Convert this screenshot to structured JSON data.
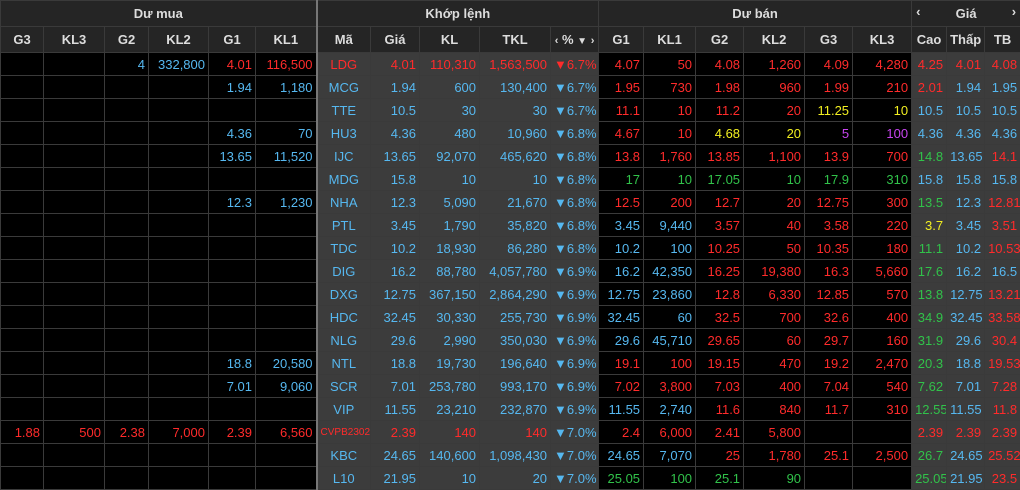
{
  "headers": {
    "buy": "Dư mua",
    "match": "Khớp lệnh",
    "sell": "Dư bán",
    "price": "Giá",
    "buy_cols": [
      "G3",
      "KL3",
      "G2",
      "KL2",
      "G1",
      "KL1"
    ],
    "match_cols": [
      "Mã",
      "Giá",
      "KL",
      "TKL",
      "%"
    ],
    "sell_cols": [
      "G1",
      "KL1",
      "G2",
      "KL2",
      "G3",
      "KL3"
    ],
    "price_cols": [
      "Cao",
      "Thấp",
      "TB"
    ],
    "pct_sort_icon": "triangle-down"
  },
  "colors": {
    "up": "#31c24a",
    "down": "#ff2b2b",
    "reference": "#e3d21d",
    "ceiling": "#c845f0",
    "floor": "#56b8f0",
    "highlight": "#f2ef21"
  },
  "rows": [
    {
      "c": [
        "",
        "",
        "4",
        "332,800",
        "4.01",
        "116,500",
        "LDG",
        "4.01",
        "110,310",
        "1,563,500",
        "▼6.7%",
        "4.07",
        "50",
        "4.08",
        "1,260",
        "4.09",
        "4,280",
        "4.25",
        "4.01",
        "4.08"
      ]
    },
    {
      "c": [
        "",
        "",
        "",
        "",
        "1.94",
        "1,180",
        "MCG",
        "1.94",
        "600",
        "130,400",
        "▼6.7%",
        "1.95",
        "730",
        "1.98",
        "960",
        "1.99",
        "210",
        "2.01",
        "1.94",
        "1.95"
      ]
    },
    {
      "c": [
        "",
        "",
        "",
        "",
        "",
        "",
        "TTE",
        "10.5",
        "30",
        "30",
        "▼6.7%",
        "11.1",
        "10",
        "11.2",
        "20",
        "11.25",
        "10",
        "10.5",
        "10.5",
        "10.5"
      ]
    },
    {
      "c": [
        "",
        "",
        "",
        "",
        "4.36",
        "70",
        "HU3",
        "4.36",
        "480",
        "10,960",
        "▼6.8%",
        "4.67",
        "10",
        "4.68",
        "20",
        "5",
        "100",
        "4.36",
        "4.36",
        "4.36"
      ]
    },
    {
      "c": [
        "",
        "",
        "",
        "",
        "13.65",
        "11,520",
        "IJC",
        "13.65",
        "92,070",
        "465,620",
        "▼6.8%",
        "13.8",
        "1,760",
        "13.85",
        "1,100",
        "13.9",
        "700",
        "14.8",
        "13.65",
        "14.1"
      ]
    },
    {
      "c": [
        "",
        "",
        "",
        "",
        "",
        "",
        "MDG",
        "15.8",
        "10",
        "10",
        "▼6.8%",
        "17",
        "10",
        "17.05",
        "10",
        "17.9",
        "310",
        "15.8",
        "15.8",
        "15.8"
      ]
    },
    {
      "c": [
        "",
        "",
        "",
        "",
        "12.3",
        "1,230",
        "NHA",
        "12.3",
        "5,090",
        "21,670",
        "▼6.8%",
        "12.5",
        "200",
        "12.7",
        "20",
        "12.75",
        "300",
        "13.5",
        "12.3",
        "12.81"
      ]
    },
    {
      "c": [
        "",
        "",
        "",
        "",
        "",
        "",
        "PTL",
        "3.45",
        "1,790",
        "35,820",
        "▼6.8%",
        "3.45",
        "9,440",
        "3.57",
        "40",
        "3.58",
        "220",
        "3.7",
        "3.45",
        "3.51"
      ]
    },
    {
      "c": [
        "",
        "",
        "",
        "",
        "",
        "",
        "TDC",
        "10.2",
        "18,930",
        "86,280",
        "▼6.8%",
        "10.2",
        "100",
        "10.25",
        "50",
        "10.35",
        "180",
        "11.1",
        "10.2",
        "10.53"
      ]
    },
    {
      "c": [
        "",
        "",
        "",
        "",
        "",
        "",
        "DIG",
        "16.2",
        "88,780",
        "4,057,780",
        "▼6.9%",
        "16.2",
        "42,350",
        "16.25",
        "19,380",
        "16.3",
        "5,660",
        "17.6",
        "16.2",
        "16.5"
      ]
    },
    {
      "c": [
        "",
        "",
        "",
        "",
        "",
        "",
        "DXG",
        "12.75",
        "367,150",
        "2,864,290",
        "▼6.9%",
        "12.75",
        "23,860",
        "12.8",
        "6,330",
        "12.85",
        "570",
        "13.8",
        "12.75",
        "13.21"
      ]
    },
    {
      "c": [
        "",
        "",
        "",
        "",
        "",
        "",
        "HDC",
        "32.45",
        "30,330",
        "255,730",
        "▼6.9%",
        "32.45",
        "60",
        "32.5",
        "700",
        "32.6",
        "400",
        "34.9",
        "32.45",
        "33.58"
      ]
    },
    {
      "c": [
        "",
        "",
        "",
        "",
        "",
        "",
        "NLG",
        "29.6",
        "2,990",
        "350,030",
        "▼6.9%",
        "29.6",
        "45,710",
        "29.65",
        "60",
        "29.7",
        "160",
        "31.9",
        "29.6",
        "30.4"
      ]
    },
    {
      "c": [
        "",
        "",
        "",
        "",
        "18.8",
        "20,580",
        "NTL",
        "18.8",
        "19,730",
        "196,640",
        "▼6.9%",
        "19.1",
        "100",
        "19.15",
        "470",
        "19.2",
        "2,470",
        "20.3",
        "18.8",
        "19.53"
      ]
    },
    {
      "c": [
        "",
        "",
        "",
        "",
        "7.01",
        "9,060",
        "SCR",
        "7.01",
        "253,780",
        "993,170",
        "▼6.9%",
        "7.02",
        "3,800",
        "7.03",
        "400",
        "7.04",
        "540",
        "7.62",
        "7.01",
        "7.28"
      ]
    },
    {
      "c": [
        "",
        "",
        "",
        "",
        "",
        "",
        "VIP",
        "11.55",
        "23,210",
        "232,870",
        "▼6.9%",
        "11.55",
        "2,740",
        "11.6",
        "840",
        "11.7",
        "310",
        "12.55",
        "11.55",
        "11.8"
      ]
    },
    {
      "c": [
        "1.88",
        "500",
        "2.38",
        "7,000",
        "2.39",
        "6,560",
        "CVPB2302",
        "2.39",
        "140",
        "140",
        "▼7.0%",
        "2.4",
        "6,000",
        "2.41",
        "5,800",
        "",
        "",
        "2.39",
        "2.39",
        "2.39"
      ]
    },
    {
      "c": [
        "",
        "",
        "",
        "",
        "",
        "",
        "KBC",
        "24.65",
        "140,600",
        "1,098,430",
        "▼7.0%",
        "24.65",
        "7,070",
        "25",
        "1,780",
        "25.1",
        "2,500",
        "26.7",
        "24.65",
        "25.52"
      ]
    },
    {
      "c": [
        "",
        "",
        "",
        "",
        "",
        "",
        "L10",
        "21.95",
        "10",
        "20",
        "▼7.0%",
        "25.05",
        "100",
        "25.1",
        "90",
        "",
        "",
        "25.05",
        "21.95",
        "23.5"
      ]
    }
  ]
}
